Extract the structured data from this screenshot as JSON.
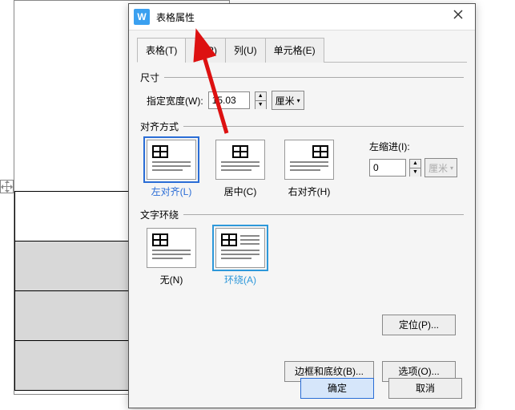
{
  "app_icon": "W",
  "dialog_title": "表格属性",
  "tabs": [
    {
      "label": "表格(T)"
    },
    {
      "label": "行(R)"
    },
    {
      "label": "列(U)"
    },
    {
      "label": "单元格(E)"
    }
  ],
  "groups": {
    "size": {
      "title": "尺寸",
      "width_label": "指定宽度(W):",
      "width_value": "15.03",
      "unit_label": "厘米"
    },
    "align": {
      "title": "对齐方式",
      "options": [
        {
          "label": "左对齐(L)"
        },
        {
          "label": "居中(C)"
        },
        {
          "label": "右对齐(H)"
        }
      ],
      "indent_label": "左缩进(I):",
      "indent_value": "0",
      "indent_unit": "厘米"
    },
    "wrap": {
      "title": "文字环绕",
      "options": [
        {
          "label": "无(N)"
        },
        {
          "label": "环绕(A)"
        }
      ]
    }
  },
  "buttons": {
    "locate": "定位(P)...",
    "border": "边框和底纹(B)...",
    "options": "选项(O)...",
    "ok": "确定",
    "cancel": "取消"
  }
}
